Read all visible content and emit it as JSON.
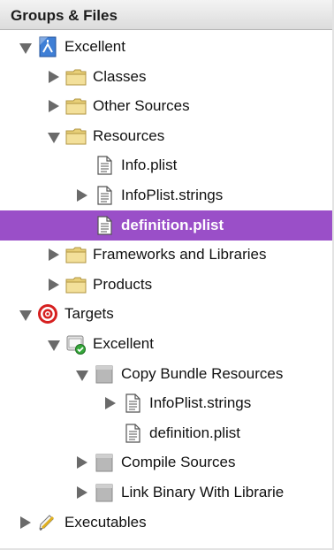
{
  "panel": {
    "title": "Groups & Files"
  },
  "tree": [
    {
      "label": "Excellent",
      "icon": "xcode-project-icon",
      "depth": 0,
      "toggle": "expanded"
    },
    {
      "label": "Classes",
      "icon": "folder-icon",
      "depth": 1,
      "toggle": "collapsed"
    },
    {
      "label": "Other Sources",
      "icon": "folder-icon",
      "depth": 1,
      "toggle": "collapsed"
    },
    {
      "label": "Resources",
      "icon": "folder-icon",
      "depth": 1,
      "toggle": "expanded"
    },
    {
      "label": "Info.plist",
      "icon": "file-icon",
      "depth": 2,
      "toggle": "none"
    },
    {
      "label": "InfoPlist.strings",
      "icon": "file-icon",
      "depth": 2,
      "toggle": "collapsed"
    },
    {
      "label": "definition.plist",
      "icon": "file-icon",
      "depth": 2,
      "toggle": "none",
      "selected": true
    },
    {
      "label": "Frameworks and Libraries",
      "icon": "folder-icon",
      "depth": 1,
      "toggle": "collapsed"
    },
    {
      "label": "Products",
      "icon": "folder-icon",
      "depth": 1,
      "toggle": "collapsed"
    },
    {
      "label": "Targets",
      "icon": "target-icon",
      "depth": 0,
      "toggle": "expanded"
    },
    {
      "label": "Excellent",
      "icon": "app-target-icon",
      "depth": 1,
      "toggle": "expanded"
    },
    {
      "label": "Copy Bundle Resources",
      "icon": "build-phase-icon",
      "depth": 2,
      "toggle": "expanded"
    },
    {
      "label": "InfoPlist.strings",
      "icon": "file-icon",
      "depth": 3,
      "toggle": "collapsed"
    },
    {
      "label": "definition.plist",
      "icon": "file-icon",
      "depth": 3,
      "toggle": "none"
    },
    {
      "label": "Compile Sources",
      "icon": "build-phase-icon",
      "depth": 2,
      "toggle": "collapsed"
    },
    {
      "label": "Link Binary With Librarie",
      "icon": "build-phase-icon",
      "depth": 2,
      "toggle": "collapsed"
    },
    {
      "label": "Executables",
      "icon": "executable-icon",
      "depth": 0,
      "toggle": "collapsed"
    }
  ],
  "colors": {
    "selection": "#9a4fc8",
    "header_bg": "#dcdcdc"
  }
}
